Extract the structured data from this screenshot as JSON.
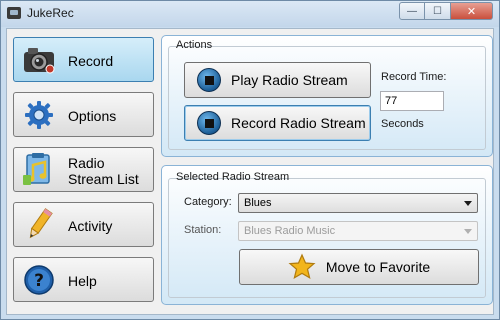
{
  "window": {
    "title": "JukeRec",
    "minimize_glyph": "—",
    "maximize_glyph": "☐",
    "close_glyph": "✕"
  },
  "nav": [
    {
      "label": "Record",
      "icon": "camera-icon",
      "active": true
    },
    {
      "label": "Options",
      "icon": "gear-icon",
      "active": false
    },
    {
      "label": "Radio Stream List",
      "icon": "music-list-icon",
      "active": false
    },
    {
      "label": "Activity",
      "icon": "pencil-icon",
      "active": false
    },
    {
      "label": "Help",
      "icon": "question-icon",
      "active": false
    }
  ],
  "actions": {
    "title": "Actions",
    "play_label": "Play Radio Stream",
    "record_label": "Record Radio Stream",
    "record_time_label": "Record Time:",
    "record_time_value": "77",
    "record_time_unit": "Seconds"
  },
  "selected_stream": {
    "title": "Selected Radio Stream",
    "category_label": "Category:",
    "category_value": "Blues",
    "station_label": "Station:",
    "station_value": "Blues Radio Music",
    "favorite_label": "Move to Favorite",
    "favorite_icon": "star-icon"
  },
  "colors": {
    "accent": "#3c7fb1",
    "panel_gradient_end": "#d3e8f6",
    "star": "#f2b51c"
  }
}
